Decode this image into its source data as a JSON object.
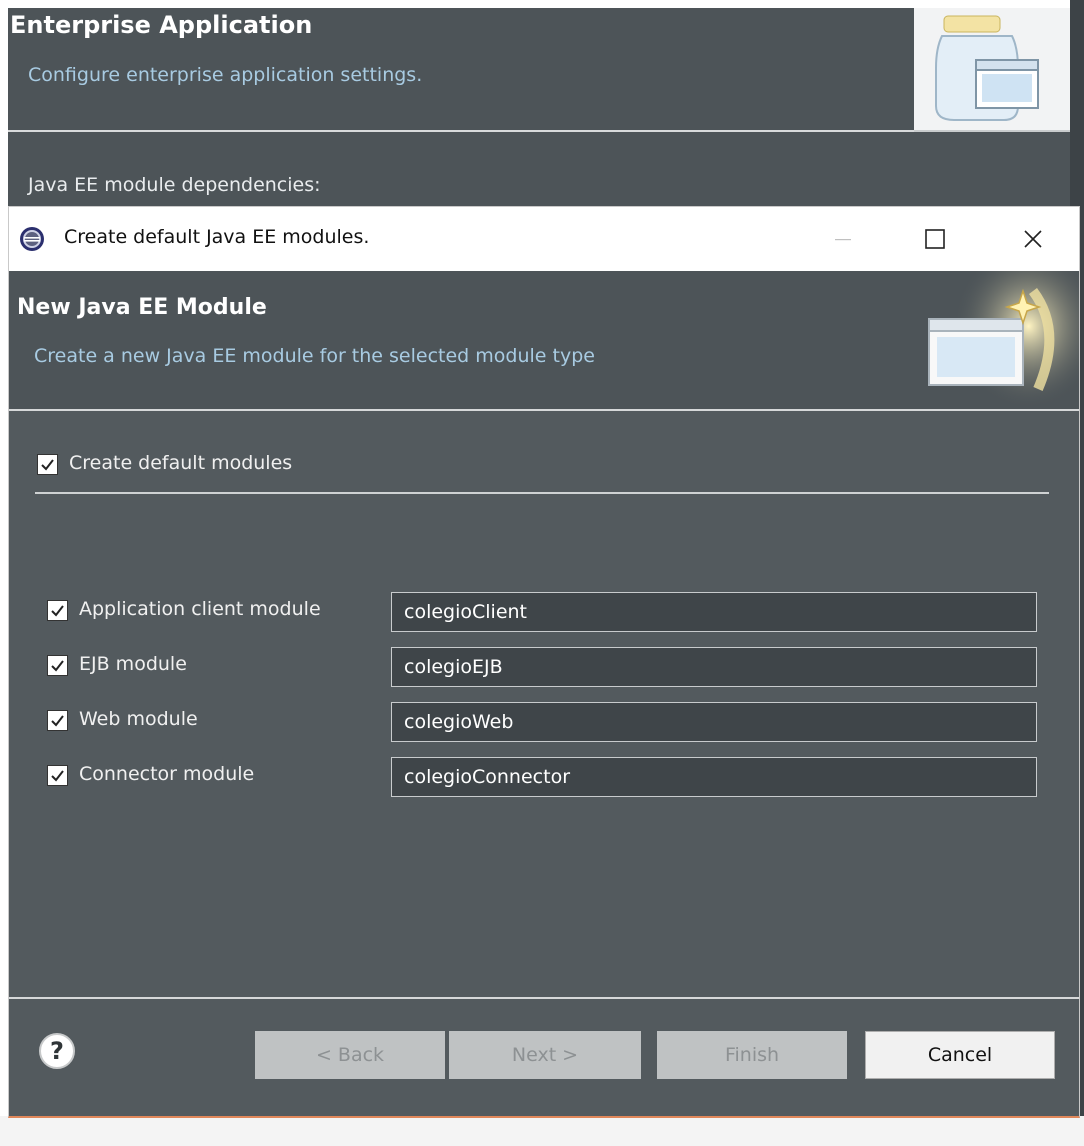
{
  "background_wizard": {
    "title": "Enterprise Application",
    "description": "Configure enterprise application settings.",
    "dependencies_label": "Java EE module dependencies:"
  },
  "dialog": {
    "window_title": "Create default Java EE modules.",
    "window_controls": {
      "minimize": "—",
      "maximize": "☐",
      "close": "✕"
    },
    "header": {
      "title": "New Java EE Module",
      "description": "Create a new Java EE module for the selected module type"
    },
    "create_default": {
      "label": "Create default modules",
      "checked": true
    },
    "modules": [
      {
        "label": "Application client module",
        "value": "colegioClient",
        "checked": true
      },
      {
        "label": "EJB module",
        "value": "colegioEJB",
        "checked": true
      },
      {
        "label": "Web module",
        "value": "colegioWeb",
        "checked": true
      },
      {
        "label": "Connector module",
        "value": "colegioConnector",
        "checked": true
      }
    ],
    "buttons": {
      "help": "?",
      "back": "< Back",
      "next": "Next >",
      "finish": "Finish",
      "cancel": "Cancel"
    }
  },
  "colors": {
    "panel": "#535a5e",
    "header": "#4d5458",
    "description_text": "#a8cbe2",
    "field_bg": "#3f4549",
    "dialog_bottom_border": "#e0875a"
  }
}
